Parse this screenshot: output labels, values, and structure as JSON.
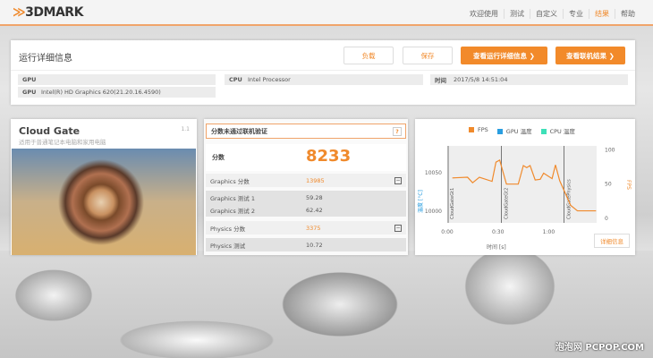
{
  "app": {
    "logo": "3DMARK",
    "accent": "#f28a2a"
  },
  "nav": [
    {
      "label": "欢迎使用"
    },
    {
      "label": "测试"
    },
    {
      "label": "自定义"
    },
    {
      "label": "专业"
    },
    {
      "label": "结果",
      "active": true
    },
    {
      "label": "帮助"
    }
  ],
  "details": {
    "title": "运行详细信息",
    "load_label": "负载",
    "save_label": "保存",
    "view_run_label": "查看运行详细信息 ❯",
    "view_online_label": "查看联机结果 ❯",
    "gpu1_key": "GPU",
    "gpu1_value": "",
    "gpu2_key": "GPU",
    "gpu2_value": "Intel(R) HD Graphics 620(21.20.16.4590)",
    "cpu_key": "CPU",
    "cpu_value": "Intel Processor",
    "time_key": "时间",
    "time_value": "2017/5/8 14:51:04"
  },
  "test": {
    "name": "Cloud Gate",
    "subtitle": "适用于普通笔记本电脑和家用电脑",
    "version": "1.1"
  },
  "scores": {
    "warning": "分数未通过联机验证",
    "help": "?",
    "score_label": "分数",
    "score_value": "8233",
    "rows": [
      {
        "name": "Graphics 分数",
        "value": "13985"
      },
      {
        "name": "Graphics 测试 1",
        "value": "59.28"
      },
      {
        "name": "Graphics 测试 2",
        "value": "62.42"
      },
      {
        "name": "Physics 分数",
        "value": "3375"
      },
      {
        "name": "Physics 测试",
        "value": "10.72"
      }
    ]
  },
  "chart_data": {
    "type": "line",
    "legend": [
      {
        "name": "FPS",
        "color": "#f08a2c"
      },
      {
        "name": "GPU 温度",
        "color": "#2a9ee0"
      },
      {
        "name": "CPU 温度",
        "color": "#3de0b8"
      }
    ],
    "xlabel": "时间 [s]",
    "xticks": [
      "0:00",
      "0:30",
      "1:00"
    ],
    "ylabel_left": "温度 [°C]",
    "yticks_left": [
      "10000",
      "10050"
    ],
    "ylabel_right": "FPS",
    "yticks_right": [
      "0",
      "50",
      "100"
    ],
    "ylim_right": [
      0,
      100
    ],
    "sections": [
      "CloudGateGt1",
      "CloudGateGt2",
      "CloudGatePhysics"
    ],
    "series": [
      {
        "name": "FPS",
        "x": [
          3,
          12,
          15,
          19,
          26.5,
          28.8,
          31,
          35,
          42,
          45,
          47,
          49,
          52,
          55,
          57,
          62,
          64,
          66.5,
          73,
          77,
          88
        ],
        "values": [
          59,
          60,
          52,
          60,
          54,
          82,
          85,
          50,
          50,
          77,
          74,
          77,
          56,
          57,
          66,
          58,
          78,
          55,
          19,
          11,
          11
        ]
      }
    ]
  },
  "chart_detail_label": "详细信息",
  "watermark": "泡泡网 PCPOP.COM"
}
